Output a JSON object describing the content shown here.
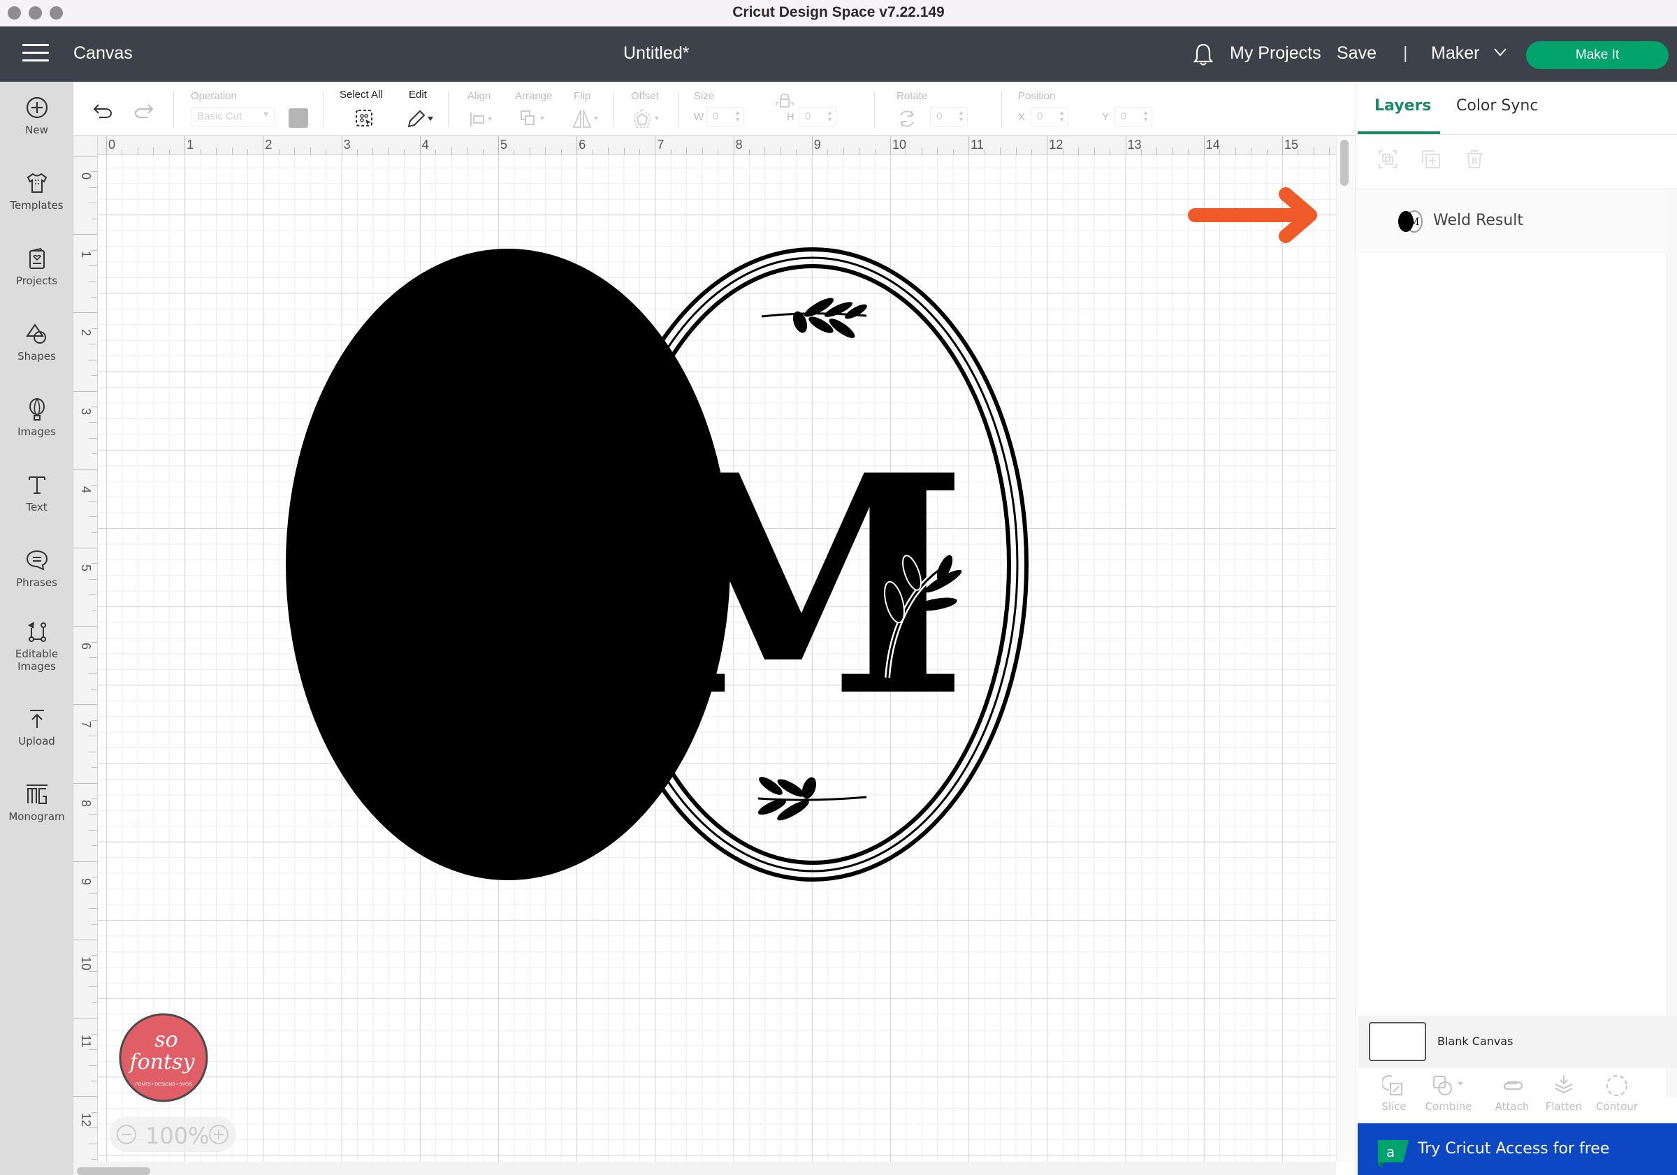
{
  "window": {
    "title": "Cricut Design Space  v7.22.149"
  },
  "header": {
    "section": "Canvas",
    "document_title": "Untitled*",
    "my_projects": "My Projects",
    "save": "Save",
    "separator": "|",
    "machine": "Maker",
    "make_it": "Make It",
    "accent_color": "#00a36c"
  },
  "sidebar": {
    "items": [
      {
        "label": "New",
        "icon": "plus-circle-icon"
      },
      {
        "label": "Templates",
        "icon": "tshirt-icon"
      },
      {
        "label": "Projects",
        "icon": "project-card-icon"
      },
      {
        "label": "Shapes",
        "icon": "shapes-icon"
      },
      {
        "label": "Images",
        "icon": "balloon-icon"
      },
      {
        "label": "Text",
        "icon": "text-icon"
      },
      {
        "label": "Phrases",
        "icon": "speech-bubble-icon"
      },
      {
        "label": "Editable",
        "label2": "Images",
        "icon": "editable-images-icon"
      },
      {
        "label": "Upload",
        "icon": "upload-icon"
      },
      {
        "label": "Monogram",
        "icon": "monogram-icon"
      }
    ]
  },
  "toolbar": {
    "operation_label": "Operation",
    "operation_value": "Basic Cut",
    "select_all_label": "Select All",
    "edit_label": "Edit",
    "align_label": "Align",
    "arrange_label": "Arrange",
    "flip_label": "Flip",
    "offset_label": "Offset",
    "size_label": "Size",
    "w_label": "W",
    "w_value": "0",
    "h_label": "H",
    "h_value": "0",
    "rotate_label": "Rotate",
    "rotate_value": "0",
    "position_label": "Position",
    "x_label": "X",
    "x_value": "0",
    "y_label": "Y",
    "y_value": "0"
  },
  "canvas": {
    "ruler_top": [
      "0",
      "1",
      "2",
      "3",
      "4",
      "5",
      "6",
      "7",
      "8",
      "9",
      "10",
      "11",
      "12",
      "13",
      "14",
      "15"
    ],
    "ruler_left": [
      "0",
      "1",
      "2",
      "3",
      "4",
      "5",
      "6",
      "7",
      "8",
      "9",
      "10",
      "11",
      "12"
    ],
    "zoom_level": "100%",
    "logo": {
      "line1": "so",
      "line2": "fontsy",
      "tagline": "FONTS • DESIGNS • SVGS",
      "color": "#e05f67"
    },
    "monogram_letter": "M",
    "annotation_arrow_color": "#f05a28"
  },
  "right_panel": {
    "tabs": [
      {
        "label": "Layers",
        "active": true
      },
      {
        "label": "Color Sync",
        "active": false
      }
    ],
    "layers": [
      {
        "name": "Weld Result"
      }
    ],
    "blank_canvas_label": "Blank Canvas",
    "bottom_tools": [
      {
        "label": "Slice"
      },
      {
        "label": "Combine"
      },
      {
        "label": "Attach"
      },
      {
        "label": "Flatten"
      },
      {
        "label": "Contour"
      }
    ],
    "access_banner": "Try Cricut Access for free",
    "access_badge_letter": "a",
    "active_tab_color": "#1c8a63",
    "banner_color": "#0c48c3"
  }
}
